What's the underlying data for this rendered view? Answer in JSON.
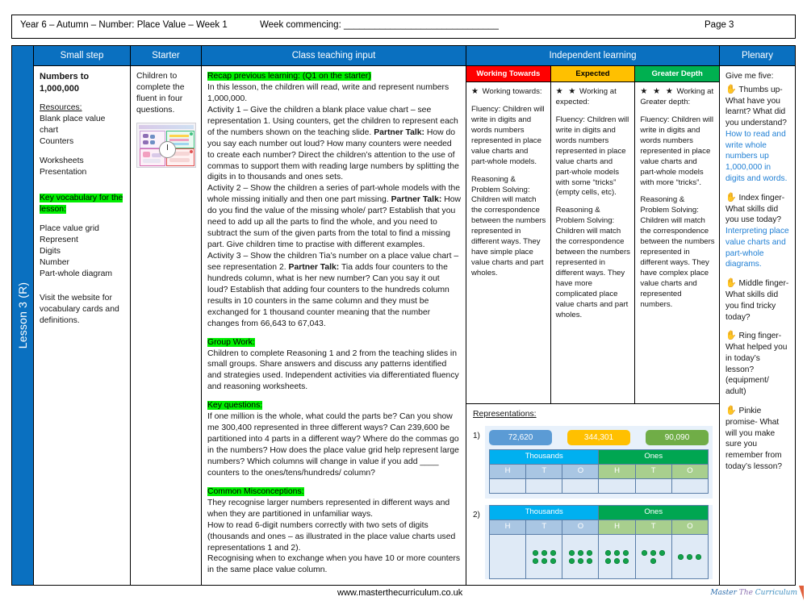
{
  "header": {
    "year_term": "Year 6 – Autumn – Number: Place Value – Week 1",
    "week_commencing": "Week commencing: ______________________________",
    "page": "Page 3"
  },
  "spine_label": "Lesson 3 (R)",
  "columns": {
    "small_step": "Small step",
    "starter": "Starter",
    "class_teaching_input": "Class teaching input",
    "independent_learning": "Independent learning",
    "plenary": "Plenary"
  },
  "small_step": {
    "title": "Numbers to 1,000,000",
    "resources_heading": "Resources:",
    "resources": [
      "Blank place value chart",
      "Counters"
    ],
    "resources_2": [
      "Worksheets",
      "Presentation"
    ],
    "key_vocab_heading": "Key vocabulary for the lesson:",
    "vocabulary": [
      "Place value grid",
      "Represent",
      "Digits",
      "Number",
      "Part-whole diagram"
    ],
    "website_note": "Visit the website for vocabulary cards and definitions."
  },
  "starter": {
    "text": "Children to complete the fluent in four questions.",
    "thumbnail_alt": "fluent-in-four-slide-thumbnail"
  },
  "teaching": {
    "recap_tag": "Recap previous learning: (Q1 on the starter)",
    "intro": "In this lesson, the children will read, write and represent numbers 1,000,000.",
    "activity1_a": "Activity 1 – Give the children a blank place value chart – see representation 1. Using counters, get the children to represent each of the numbers shown on the teaching slide. ",
    "activity1_bold": "Partner Talk:",
    "activity1_b": " How do you say each number out loud? How many counters were needed to create each number? Direct the children’s attention to the use of commas to support them with reading large numbers by splitting the digits in to thousands and ones sets.",
    "activity2_a": "Activity 2 – Show the children a series of part-whole models with the whole missing initially and then one part missing. ",
    "activity2_bold": "Partner Talk:",
    "activity2_b": " How do you find the value of the missing whole/ part? Establish that you need to add up all the parts to find the whole, and you need to subtract the sum of the given parts from the total to find a missing part. Give children time to practise with different examples.",
    "activity3_a": "Activity 3 – Show the children Tia’s number on a place value chart – see representation 2. ",
    "activity3_bold": "Partner Talk:",
    "activity3_b": " Tia adds four counters to the hundreds column, what is her new  number? Can you say it out loud? Establish that adding four counters to the hundreds column results in 10 counters  in the same column and they must be exchanged for 1 thousand counter meaning that the number changes from 66,643 to 67,043.",
    "group_work_tag": "Group Work:",
    "group_work": "Children to complete Reasoning 1 and 2 from the teaching slides in small groups. Share answers and discuss any patterns identified and strategies used. Independent activities via differentiated fluency and reasoning worksheets.",
    "key_questions_tag": "Key questions:",
    "key_questions": "If one million is the whole, what could the parts be?  Can you show me 300,400 represented in three different ways? Can 239,600 be partitioned into 4 parts in a different way? Where do the commas go in the numbers? How does the place value grid help represent large numbers? Which columns will change in value if you add ____ counters to the ones/tens/hundreds/ column?",
    "misconceptions_tag": "Common Misconceptions:",
    "misconceptions": "They recognise larger numbers represented in different ways and when they are partitioned in unfamiliar ways.\nHow to read 6-digit numbers correctly with two sets of digits (thousands and ones – as illustrated in the place value charts used representations 1 and 2).\nRecognising when to exchange when you have 10 or more counters in the same place value column."
  },
  "independent": [
    {
      "band": "Working Towards",
      "band_color": "#ff0000",
      "stars": "★",
      "lead": " Working towards:",
      "fluency": "Fluency: Children will write in digits and words numbers represented in place value charts and part-whole models.",
      "reasoning": "Reasoning & Problem Solving: Children will match the correspondence between the numbers represented in different ways. They have simple place value charts and part wholes."
    },
    {
      "band": "Expected",
      "band_color": "#ffc000",
      "stars": "★ ★",
      "lead": " Working at expected:",
      "fluency": "Fluency: Children will write in digits and words numbers represented in place value charts and part-whole models with some “tricks” (empty cells, etc).",
      "reasoning": "Reasoning & Problem Solving: Children will match the correspondence between the numbers represented in different ways. They have more complicated place value charts and part wholes."
    },
    {
      "band": "Greater Depth",
      "band_color": "#00b050",
      "stars": "★ ★ ★",
      "lead": " Working at Greater depth:",
      "fluency": "Fluency: Children will write in digits and words numbers represented in place value charts and part-whole models with more “tricks”.",
      "reasoning": "Reasoning & Problem Solving: Children will match the correspondence between the numbers represented in different ways. They have complex place value charts and represented numbers."
    }
  ],
  "representations": {
    "title": "Representations:",
    "rep1": {
      "number": "1)",
      "chips": [
        {
          "value": "72,620",
          "color": "#5b9bd5"
        },
        {
          "value": "344,301",
          "color": "#ffc000"
        },
        {
          "value": "90,090",
          "color": "#70ad47"
        }
      ],
      "group_headers": [
        "Thousands",
        "Ones"
      ],
      "sub_headers": [
        "H",
        "T",
        "O",
        "H",
        "T",
        "O"
      ],
      "counts": [
        0,
        0,
        0,
        0,
        0,
        0
      ]
    },
    "rep2": {
      "number": "2)",
      "group_headers": [
        "Thousands",
        "Ones"
      ],
      "sub_headers": [
        "H",
        "T",
        "O",
        "H",
        "T",
        "O"
      ],
      "counts": [
        0,
        6,
        6,
        6,
        4,
        3
      ],
      "counter_color": "#13a14a"
    }
  },
  "plenary": {
    "intro": "Give me five:",
    "items": [
      {
        "icon": "hand-thumbs-up-icon",
        "prompt": " Thumbs up- What have you learnt? What did you understand?",
        "answer": "How to read and write whole numbers up 1,000,000 in digits and words."
      },
      {
        "icon": "hand-index-finger-icon",
        "prompt": " Index finger- What skills did you use today?",
        "answer": "Interpreting place value charts and part-whole diagrams."
      },
      {
        "icon": "hand-middle-finger-icon",
        "prompt": " Middle finger- What skills did you find tricky today?",
        "answer": ""
      },
      {
        "icon": "hand-ring-finger-icon",
        "prompt": " Ring finger- What helped you in today’s lesson? (equipment/ adult)",
        "answer": ""
      },
      {
        "icon": "hand-pinkie-icon",
        "prompt": " Pinkie promise- What will you make sure you remember from today’s lesson?",
        "answer": ""
      }
    ],
    "answer_color": "#1f7fd4"
  },
  "footer": {
    "url": "www.masterthecurriculum.co.uk",
    "logo_words": [
      "Master",
      "The",
      "Curriculum"
    ]
  }
}
